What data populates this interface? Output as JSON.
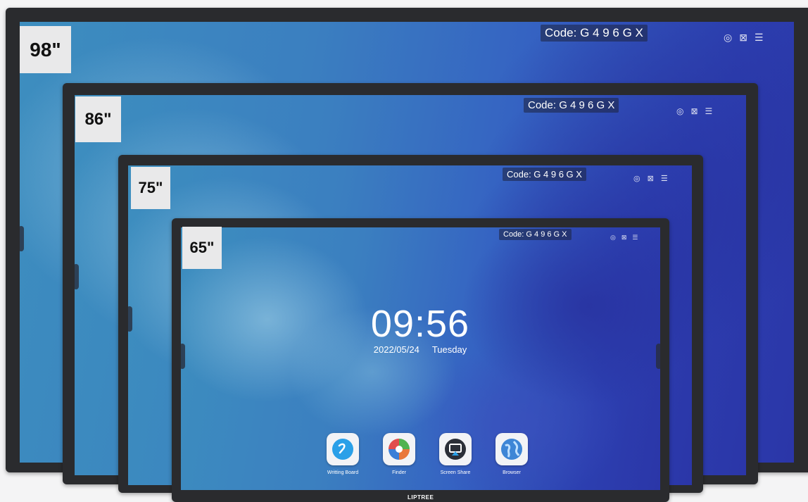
{
  "displays": [
    {
      "size": "98\"",
      "code": "Code: G 4 9 6 G X"
    },
    {
      "size": "86\"",
      "code": "Code: G 4 9 6 G X"
    },
    {
      "size": "75\"",
      "code": "Code: G 4 9 6 G X"
    },
    {
      "size": "65\"",
      "code": "Code: G 4 9 6 G X"
    }
  ],
  "home": {
    "time": "09:56",
    "date": "2022/05/24",
    "weekday": "Tuesday"
  },
  "apps": [
    {
      "label": "Writting Board",
      "icon": "writing-board-icon"
    },
    {
      "label": "Finder",
      "icon": "finder-icon"
    },
    {
      "label": "Screen Share",
      "icon": "screen-share-icon"
    },
    {
      "label": "Browser",
      "icon": "browser-icon"
    }
  ],
  "status_icons": [
    "hotspot-icon",
    "camera-off-icon",
    "wifi-icon"
  ],
  "brand": "LIPTREE",
  "colors": {
    "bezel": "#2a2b2e",
    "label_bg": "#e9e9ea",
    "screen_left": "#3d8ebf",
    "screen_right": "#2b36a8"
  }
}
